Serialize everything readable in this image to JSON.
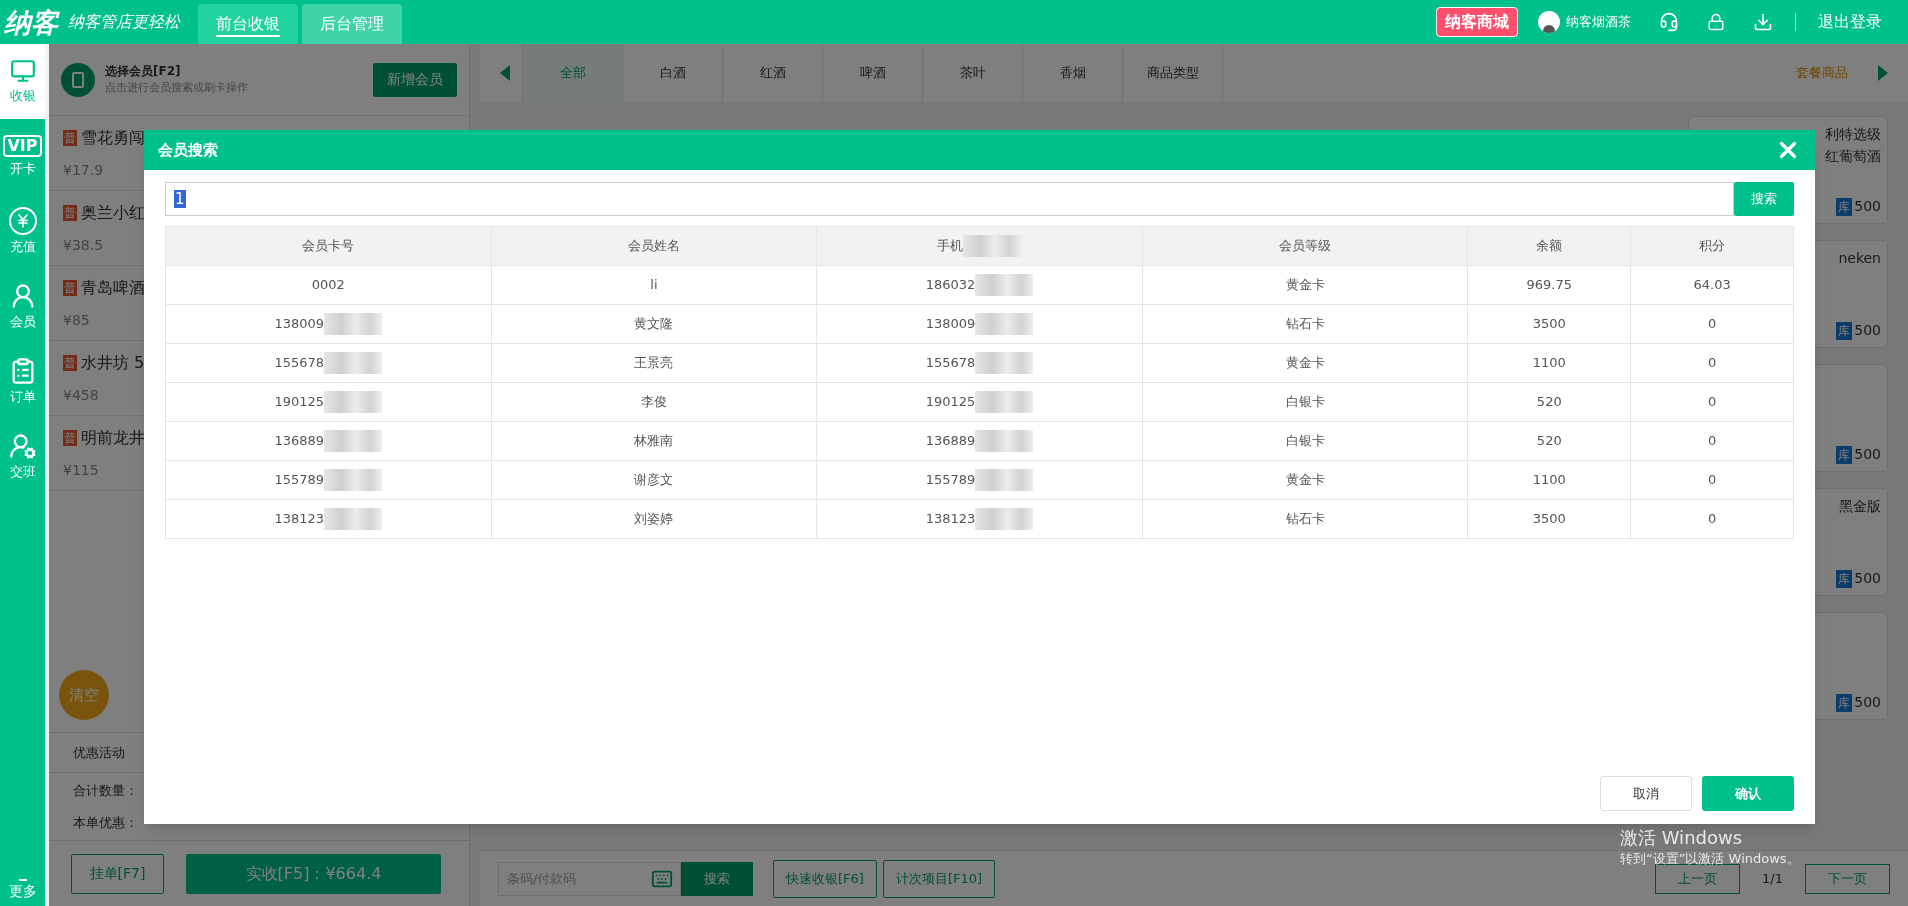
{
  "topbar": {
    "logo": "纳客",
    "slogan": "纳客管店更轻松",
    "tabs": [
      {
        "label": "前台收银",
        "selected": true
      },
      {
        "label": "后台管理",
        "selected": false
      }
    ],
    "mall": "纳客商城",
    "user": "纳客烟酒茶",
    "logout": "退出登录"
  },
  "sidebar": [
    {
      "kind": "register",
      "label": "收银",
      "selected": true
    },
    {
      "kind": "vip",
      "badge": "VIP",
      "label": "开卡",
      "selected": false
    },
    {
      "kind": "recharge",
      "label": "充值",
      "selected": false
    },
    {
      "kind": "member",
      "label": "会员",
      "selected": false
    },
    {
      "kind": "orders",
      "label": "订单",
      "selected": false
    },
    {
      "kind": "shift",
      "label": "交班",
      "selected": false
    }
  ],
  "sidebar_more": "更多",
  "member": {
    "title": "选择会员[F2]",
    "hint": "点击进行会员搜索或刷卡操作",
    "add_button": "新增会员"
  },
  "cart": [
    {
      "tag": "普",
      "name": "雪花勇闯",
      "price": "¥17.9"
    },
    {
      "tag": "普",
      "name": "奥兰小红",
      "price": "¥38.5"
    },
    {
      "tag": "普",
      "name": "青岛啤酒",
      "price": "¥85"
    },
    {
      "tag": "普",
      "name": "水井坊 5",
      "price": "¥458"
    },
    {
      "tag": "普",
      "name": "明前龙井",
      "price": "¥115"
    }
  ],
  "clear_button": "清空",
  "promo": "优惠活动",
  "totals": [
    "合计数量：",
    "本单优惠："
  ],
  "hold_button": "挂单[F7]",
  "pay_button": "实收[F5]：¥664.4",
  "categories": [
    {
      "label": "全部",
      "selected": true
    },
    {
      "label": "白酒",
      "selected": false
    },
    {
      "label": "红酒",
      "selected": false
    },
    {
      "label": "啤酒",
      "selected": false
    },
    {
      "label": "茶叶",
      "selected": false
    },
    {
      "label": "香烟",
      "selected": false
    },
    {
      "label": "商品类型",
      "selected": false
    }
  ],
  "package_tab": "套餐商品",
  "products": [
    {
      "lines": [
        "利特选级",
        "红葡萄酒"
      ],
      "stock_tag": "库",
      "stock": "500"
    },
    {
      "lines": [
        "neken"
      ],
      "stock_tag": "库",
      "stock": "500"
    },
    {
      "stock_tag": "库",
      "stock": "500"
    },
    {
      "lines": [
        "黑金版"
      ],
      "stock_tag": "库",
      "stock": "500"
    },
    {
      "stock_tag": "库",
      "stock": "500"
    }
  ],
  "bottom": {
    "barcode_placeholder": "条码/付款码",
    "search": "搜索",
    "quick": "快速收银[F6]",
    "count": "计次项目[F10]",
    "prev": "上一页",
    "page": "1/1",
    "next": "下一页"
  },
  "modal": {
    "title": "会员搜索",
    "query": "1",
    "search_button": "搜索",
    "columns": [
      {
        "label": "会员卡号",
        "masked": false
      },
      {
        "label": "会员姓名",
        "masked": false
      },
      {
        "label": "手机",
        "masked": true
      },
      {
        "label": "会员等级",
        "masked": false
      },
      {
        "label": "余额",
        "masked": false
      },
      {
        "label": "积分",
        "masked": false
      }
    ],
    "rows": [
      {
        "card": "0002",
        "card_masked": false,
        "name": "li",
        "phone": "186032",
        "phone_masked": true,
        "level": "黄金卡",
        "balance": "969.75",
        "points": "64.03"
      },
      {
        "card": "138009",
        "card_masked": true,
        "name": "黄文隆",
        "phone": "138009",
        "phone_masked": true,
        "level": "钻石卡",
        "balance": "3500",
        "points": "0"
      },
      {
        "card": "155678",
        "card_masked": true,
        "name": "王景亮",
        "phone": "155678",
        "phone_masked": true,
        "level": "黄金卡",
        "balance": "1100",
        "points": "0"
      },
      {
        "card": "190125",
        "card_masked": true,
        "name": "李俊",
        "phone": "190125",
        "phone_masked": true,
        "level": "白银卡",
        "balance": "520",
        "points": "0"
      },
      {
        "card": "136889",
        "card_masked": true,
        "name": "林雅南",
        "phone": "136889",
        "phone_masked": true,
        "level": "白银卡",
        "balance": "520",
        "points": "0"
      },
      {
        "card": "155789",
        "card_masked": true,
        "name": "谢彦文",
        "phone": "155789",
        "phone_masked": true,
        "level": "黄金卡",
        "balance": "1100",
        "points": "0"
      },
      {
        "card": "138123",
        "card_masked": true,
        "name": "刘姿婷",
        "phone": "138123",
        "phone_masked": true,
        "level": "钻石卡",
        "balance": "3500",
        "points": "0"
      }
    ],
    "cancel": "取消",
    "confirm": "确认"
  },
  "activation_notice": [
    "激活 Windows",
    "转到“设置”以激活 Windows。"
  ]
}
